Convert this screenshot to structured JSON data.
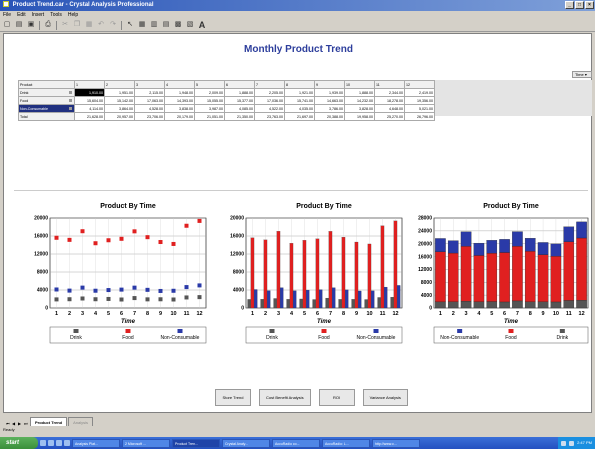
{
  "window": {
    "title": "Product Trend.car - Crystal Analysis Professional"
  },
  "menu": [
    "File",
    "Edit",
    "Insert",
    "Tools",
    "Help"
  ],
  "report": {
    "title": "Monthly Product Trend"
  },
  "time_dimension": {
    "label": "Time"
  },
  "grid": {
    "dimension_label": "Product",
    "columns": [
      "1",
      "2",
      "3",
      "4",
      "5",
      "6",
      "7",
      "8",
      "9",
      "10",
      "11",
      "12"
    ],
    "rows": [
      {
        "label": "Drink",
        "values": [
          "1,910.00",
          "1,951.00",
          "2,115.00",
          "1,948.00",
          "2,009.00",
          "1,888.00",
          "2,205.00",
          "1,921.00",
          "1,939.00",
          "1,888.00",
          "2,344.00",
          "2,419.00"
        ]
      },
      {
        "label": "Food",
        "values": [
          "15,604.00",
          "15,142.00",
          "17,063.00",
          "14,393.00",
          "15,055.00",
          "15,377.00",
          "17,036.00",
          "15,741.00",
          "14,663.00",
          "14,232.00",
          "18,278.00",
          "19,356.00"
        ]
      },
      {
        "label": "Non-Consumable",
        "values": [
          "4,114.00",
          "3,864.00",
          "4,528.00",
          "3,838.00",
          "3,987.00",
          "4,085.00",
          "4,522.00",
          "4,035.00",
          "3,786.00",
          "3,828.00",
          "4,648.00",
          "5,021.00"
        ]
      },
      {
        "label": "Total",
        "values": [
          "21,628.00",
          "20,957.00",
          "23,706.00",
          "20,179.00",
          "21,051.00",
          "21,350.00",
          "23,763.00",
          "21,697.00",
          "20,388.00",
          "19,958.00",
          "25,270.00",
          "26,796.00"
        ]
      }
    ]
  },
  "colors": {
    "drink": "#555555",
    "food": "#e02020",
    "non_consumable": "#2a3aa8",
    "title": "#2d3e9c"
  },
  "chart_data": [
    {
      "type": "scatter",
      "title": "Product By Time",
      "xlabel": "Time",
      "ylabel": "",
      "categories": [
        "1",
        "2",
        "3",
        "4",
        "5",
        "6",
        "7",
        "8",
        "9",
        "10",
        "11",
        "12"
      ],
      "ylim": [
        0,
        20000
      ],
      "yticks": [
        "0",
        "4000",
        "8000",
        "12000",
        "16000",
        "20000"
      ],
      "series": [
        {
          "name": "Drink",
          "values": [
            1910,
            1951,
            2115,
            1948,
            2009,
            1888,
            2205,
            1921,
            1939,
            1888,
            2344,
            2419
          ]
        },
        {
          "name": "Food",
          "values": [
            15604,
            15142,
            17063,
            14393,
            15055,
            15377,
            17036,
            15741,
            14663,
            14232,
            18278,
            19356
          ]
        },
        {
          "name": "Non-Consumable",
          "values": [
            4114,
            3864,
            4528,
            3838,
            3987,
            4085,
            4522,
            4035,
            3786,
            3828,
            4648,
            5021
          ]
        }
      ],
      "legend": [
        "Drink",
        "Food",
        "Non-Consumable"
      ],
      "grid": true,
      "legend_position": "bottom"
    },
    {
      "type": "bar",
      "title": "Product By Time",
      "xlabel": "Time",
      "ylabel": "",
      "categories": [
        "1",
        "2",
        "3",
        "4",
        "5",
        "6",
        "7",
        "8",
        "9",
        "10",
        "11",
        "12"
      ],
      "ylim": [
        0,
        20000
      ],
      "yticks": [
        "0",
        "4000",
        "8000",
        "12000",
        "16000",
        "20000"
      ],
      "series": [
        {
          "name": "Drink",
          "values": [
            1910,
            1951,
            2115,
            1948,
            2009,
            1888,
            2205,
            1921,
            1939,
            1888,
            2344,
            2419
          ]
        },
        {
          "name": "Food",
          "values": [
            15604,
            15142,
            17063,
            14393,
            15055,
            15377,
            17036,
            15741,
            14663,
            14232,
            18278,
            19356
          ]
        },
        {
          "name": "Non-Consumable",
          "values": [
            4114,
            3864,
            4528,
            3838,
            3987,
            4085,
            4522,
            4035,
            3786,
            3828,
            4648,
            5021
          ]
        }
      ],
      "legend": [
        "Drink",
        "Food",
        "Non-Consumable"
      ],
      "grid": true,
      "legend_position": "bottom"
    },
    {
      "type": "bar",
      "stacked": true,
      "title": "Product By Time",
      "xlabel": "Time",
      "ylabel": "",
      "categories": [
        "1",
        "2",
        "3",
        "4",
        "5",
        "6",
        "7",
        "8",
        "9",
        "10",
        "11",
        "12"
      ],
      "ylim": [
        0,
        28000
      ],
      "yticks": [
        "0",
        "4000",
        "8000",
        "12000",
        "16000",
        "20000",
        "24000",
        "28000"
      ],
      "series": [
        {
          "name": "Drink",
          "values": [
            1910,
            1951,
            2115,
            1948,
            2009,
            1888,
            2205,
            1921,
            1939,
            1888,
            2344,
            2419
          ]
        },
        {
          "name": "Food",
          "values": [
            15604,
            15142,
            17063,
            14393,
            15055,
            15377,
            17036,
            15741,
            14663,
            14232,
            18278,
            19356
          ]
        },
        {
          "name": "Non-Consumable",
          "values": [
            4114,
            3864,
            4528,
            3838,
            3987,
            4085,
            4522,
            4035,
            3786,
            3828,
            4648,
            5021
          ]
        }
      ],
      "legend": [
        "Non-Consumable",
        "Food",
        "Drink"
      ],
      "grid": true,
      "legend_position": "bottom"
    }
  ],
  "actions": [
    "Store Trend",
    "Cost Benefit Analysis",
    "ROI",
    "Variance Analysis"
  ],
  "sheets": [
    "Product Trend",
    "Analysis"
  ],
  "status": "Ready",
  "taskbar": {
    "start": "start",
    "tasks": [
      "Analysis Plat...",
      "2 Microsoft ...",
      "Product Tren...",
      "Crystal Analy...",
      "AccuRadio co...",
      "AccuRadio: L...",
      "http://www.c..."
    ],
    "clock": "2:47 PM"
  }
}
